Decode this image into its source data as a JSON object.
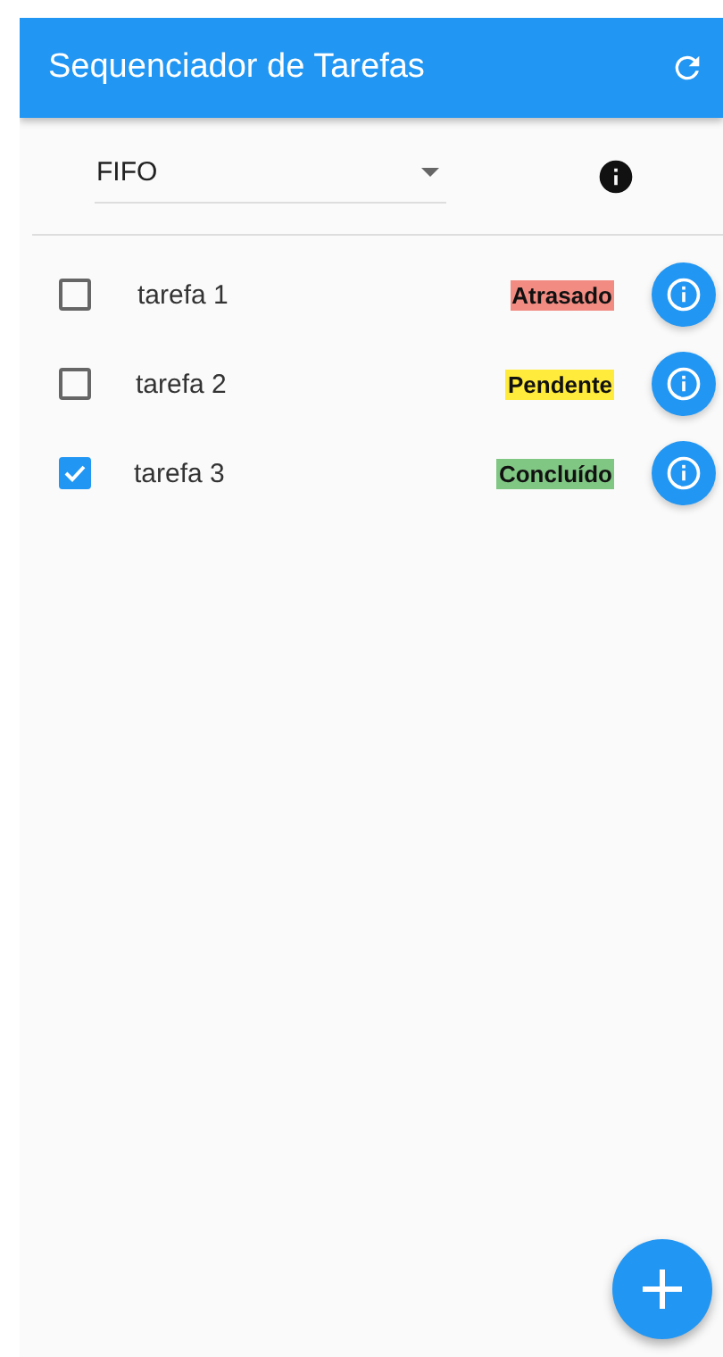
{
  "app_bar": {
    "title": "Sequenciador de Tarefas"
  },
  "scheduler": {
    "value": "FIFO"
  },
  "tasks": [
    {
      "name": "tarefa 1",
      "checked": false,
      "status": "Atrasado",
      "color": "#f28b82"
    },
    {
      "name": "tarefa 2",
      "checked": false,
      "status": "Pendente",
      "color": "#ffeb3b"
    },
    {
      "name": "tarefa 3",
      "checked": true,
      "status": "Concluído",
      "color": "#81c784"
    }
  ]
}
